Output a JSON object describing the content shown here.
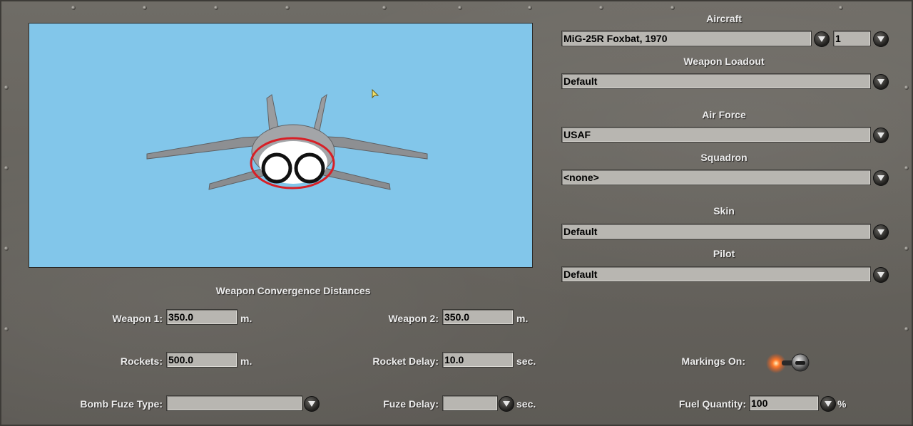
{
  "aircraft": {
    "label": "Aircraft",
    "value": "MiG-25R Foxbat, 1970",
    "count": "1"
  },
  "weapon_loadout": {
    "label": "Weapon Loadout",
    "value": "Default"
  },
  "air_force": {
    "label": "Air Force",
    "value": "USAF"
  },
  "squadron": {
    "label": "Squadron",
    "value": "<none>"
  },
  "skin": {
    "label": "Skin",
    "value": "Default"
  },
  "pilot": {
    "label": "Pilot",
    "value": "Default"
  },
  "convergence": {
    "title": "Weapon Convergence Distances",
    "weapon1": {
      "label": "Weapon 1:",
      "value": "350.0",
      "unit": "m."
    },
    "weapon2": {
      "label": "Weapon 2:",
      "value": "350.0",
      "unit": "m."
    },
    "rockets": {
      "label": "Rockets:",
      "value": "500.0",
      "unit": "m."
    },
    "rocket_delay": {
      "label": "Rocket Delay:",
      "value": "10.0",
      "unit": "sec."
    },
    "bomb_fuze_type": {
      "label": "Bomb Fuze Type:",
      "value": ""
    },
    "fuze_delay": {
      "label": "Fuze Delay:",
      "value": "",
      "unit": "sec."
    }
  },
  "markings": {
    "label": "Markings On:",
    "on": true
  },
  "fuel": {
    "label": "Fuel Quantity:",
    "value": "100",
    "unit": "%"
  },
  "icons": {
    "dropdown": "chevron-down-icon",
    "preview_aircraft": "aircraft-rear-view",
    "cursor": "mouse-cursor-icon"
  },
  "colors": {
    "sky": "#82c6ea",
    "field_bg": "#b8b6b1",
    "label_text": "#ececec",
    "highlight_ring": "#d81f26",
    "toggle_light": "#ff7a2a"
  }
}
